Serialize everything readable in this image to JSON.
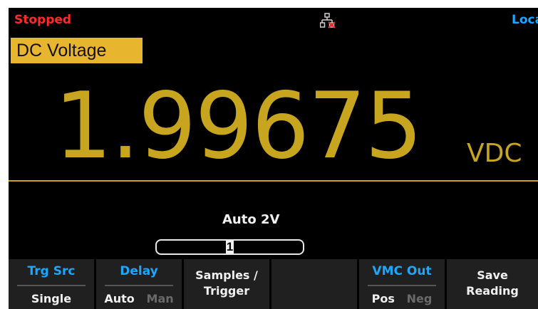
{
  "status": {
    "state": "Stopped",
    "remote": "Loca",
    "network_icon": "network-disconnected-icon"
  },
  "measurement": {
    "mode": "DC Voltage",
    "value": "1.99675",
    "unit": "VDC",
    "range": "Auto  2V"
  },
  "input": {
    "value": "1"
  },
  "softkeys": [
    {
      "title": "Trg Src",
      "value": "Single"
    },
    {
      "title": "Delay",
      "options": [
        "Auto",
        "Man"
      ],
      "selected": "Auto"
    },
    {
      "line1": "Samples /",
      "line2": "Trigger"
    },
    {
      "label": ""
    },
    {
      "title": "VMC Out",
      "options": [
        "Pos",
        "Neg"
      ],
      "selected": "Pos"
    },
    {
      "line1": "Save",
      "line2": "Reading"
    }
  ],
  "colors": {
    "accent_yellow": "#c7a51f",
    "mode_tag_bg": "#e8b52e",
    "status_red": "#ff2a2a",
    "softkey_blue": "#1aa7ff"
  }
}
